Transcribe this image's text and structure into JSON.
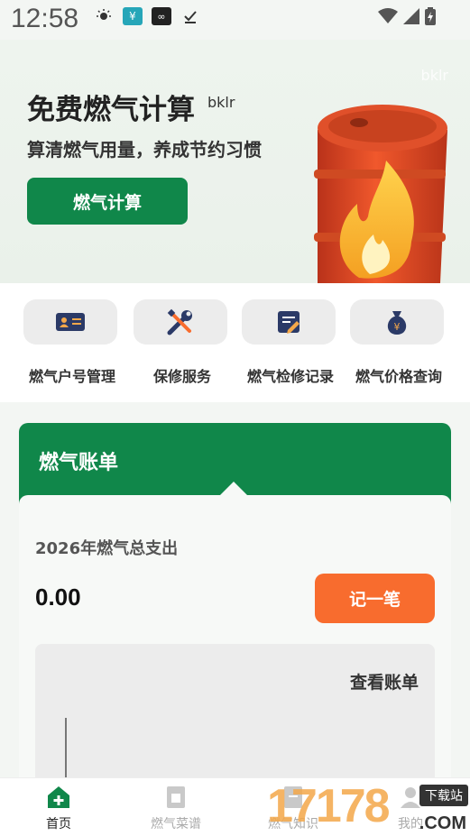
{
  "status_bar": {
    "time": "12:58",
    "icons": [
      "brightness-icon",
      "yuan-app-icon",
      "glasses-app-icon",
      "download-done-icon"
    ],
    "right_icons": [
      "wifi-icon",
      "signal-icon",
      "battery-icon"
    ]
  },
  "hero": {
    "title": "免费燃气计算",
    "tag": "bklr",
    "watermark": "bklr",
    "subtitle": "算清燃气用量，养成节约习惯",
    "button_label": "燃气计算"
  },
  "quick_actions": [
    {
      "label": "燃气户号管理",
      "icon": "id-card-icon"
    },
    {
      "label": "保修服务",
      "icon": "wrench-screwdriver-icon"
    },
    {
      "label": "燃气检修记录",
      "icon": "edit-document-icon"
    },
    {
      "label": "燃气价格查询",
      "icon": "money-bag-icon"
    }
  ],
  "bill_card": {
    "title": "燃气账单",
    "year_label": "2026年燃气总支出",
    "total": "0.00",
    "record_button": "记一笔",
    "view_bill": "查看账单"
  },
  "tabbar": {
    "tabs": [
      {
        "label": "首页",
        "icon": "home-plus-icon",
        "active": true
      },
      {
        "label": "燃气菜谱",
        "icon": "recipe-icon",
        "active": false
      },
      {
        "label": "燃气知识",
        "icon": "knowledge-icon",
        "active": false
      },
      {
        "label": "我的",
        "icon": "profile-icon",
        "active": false
      }
    ]
  },
  "watermark_site": {
    "number": "17178",
    "tag": "下载站",
    "suffix": ".COM"
  },
  "colors": {
    "primary_green": "#10874a",
    "accent_orange": "#f86c2e",
    "icon_navy": "#2b3a67"
  }
}
